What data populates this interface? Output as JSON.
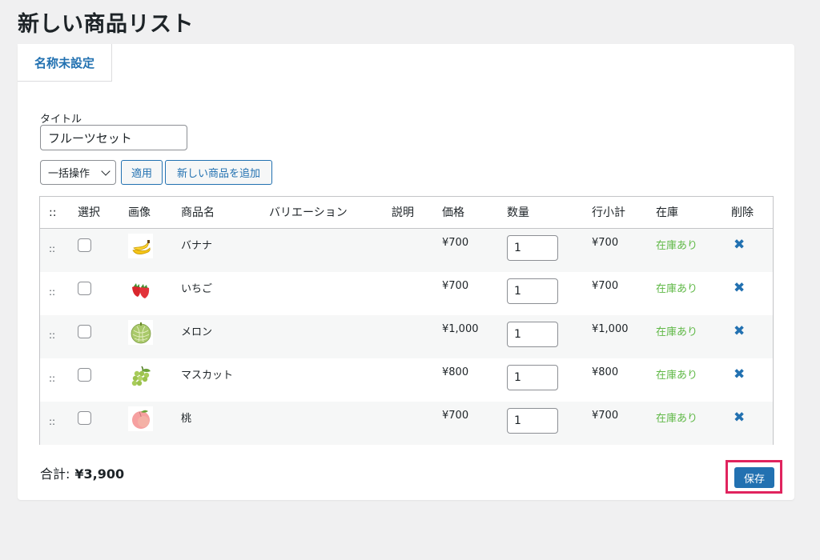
{
  "page_title": "新しい商品リスト",
  "tab_label": "名称未設定",
  "title_field": {
    "label": "タイトル",
    "value": "フルーツセット"
  },
  "bulk_action": {
    "selected": "一括操作"
  },
  "buttons": {
    "apply": "適用",
    "add_product": "新しい商品を追加",
    "save": "保存"
  },
  "table": {
    "headers": {
      "handle": "::",
      "select": "選択",
      "image": "画像",
      "name": "商品名",
      "variation": "バリエーション",
      "description": "説明",
      "price": "価格",
      "quantity": "数量",
      "subtotal": "行小計",
      "stock": "在庫",
      "delete": "削除"
    },
    "rows": [
      {
        "handle": "::",
        "image_icon": "banana-icon",
        "name": "バナナ",
        "price": "¥700",
        "qty": "1",
        "subtotal": "¥700",
        "stock": "在庫あり",
        "delete": "✖"
      },
      {
        "handle": "::",
        "image_icon": "strawberry-icon",
        "name": "いちご",
        "price": "¥700",
        "qty": "1",
        "subtotal": "¥700",
        "stock": "在庫あり",
        "delete": "✖"
      },
      {
        "handle": "::",
        "image_icon": "melon-icon",
        "name": "メロン",
        "price": "¥1,000",
        "qty": "1",
        "subtotal": "¥1,000",
        "stock": "在庫あり",
        "delete": "✖"
      },
      {
        "handle": "::",
        "image_icon": "grapes-icon",
        "name": "マスカット",
        "price": "¥800",
        "qty": "1",
        "subtotal": "¥800",
        "stock": "在庫あり",
        "delete": "✖"
      },
      {
        "handle": "::",
        "image_icon": "peach-icon",
        "name": "桃",
        "price": "¥700",
        "qty": "1",
        "subtotal": "¥700",
        "stock": "在庫あり",
        "delete": "✖"
      }
    ]
  },
  "total": {
    "label": "合計:",
    "value": "¥3,900"
  },
  "colors": {
    "accent": "#2271b1",
    "stock_green": "#5fb846",
    "highlight": "#e0245e"
  }
}
